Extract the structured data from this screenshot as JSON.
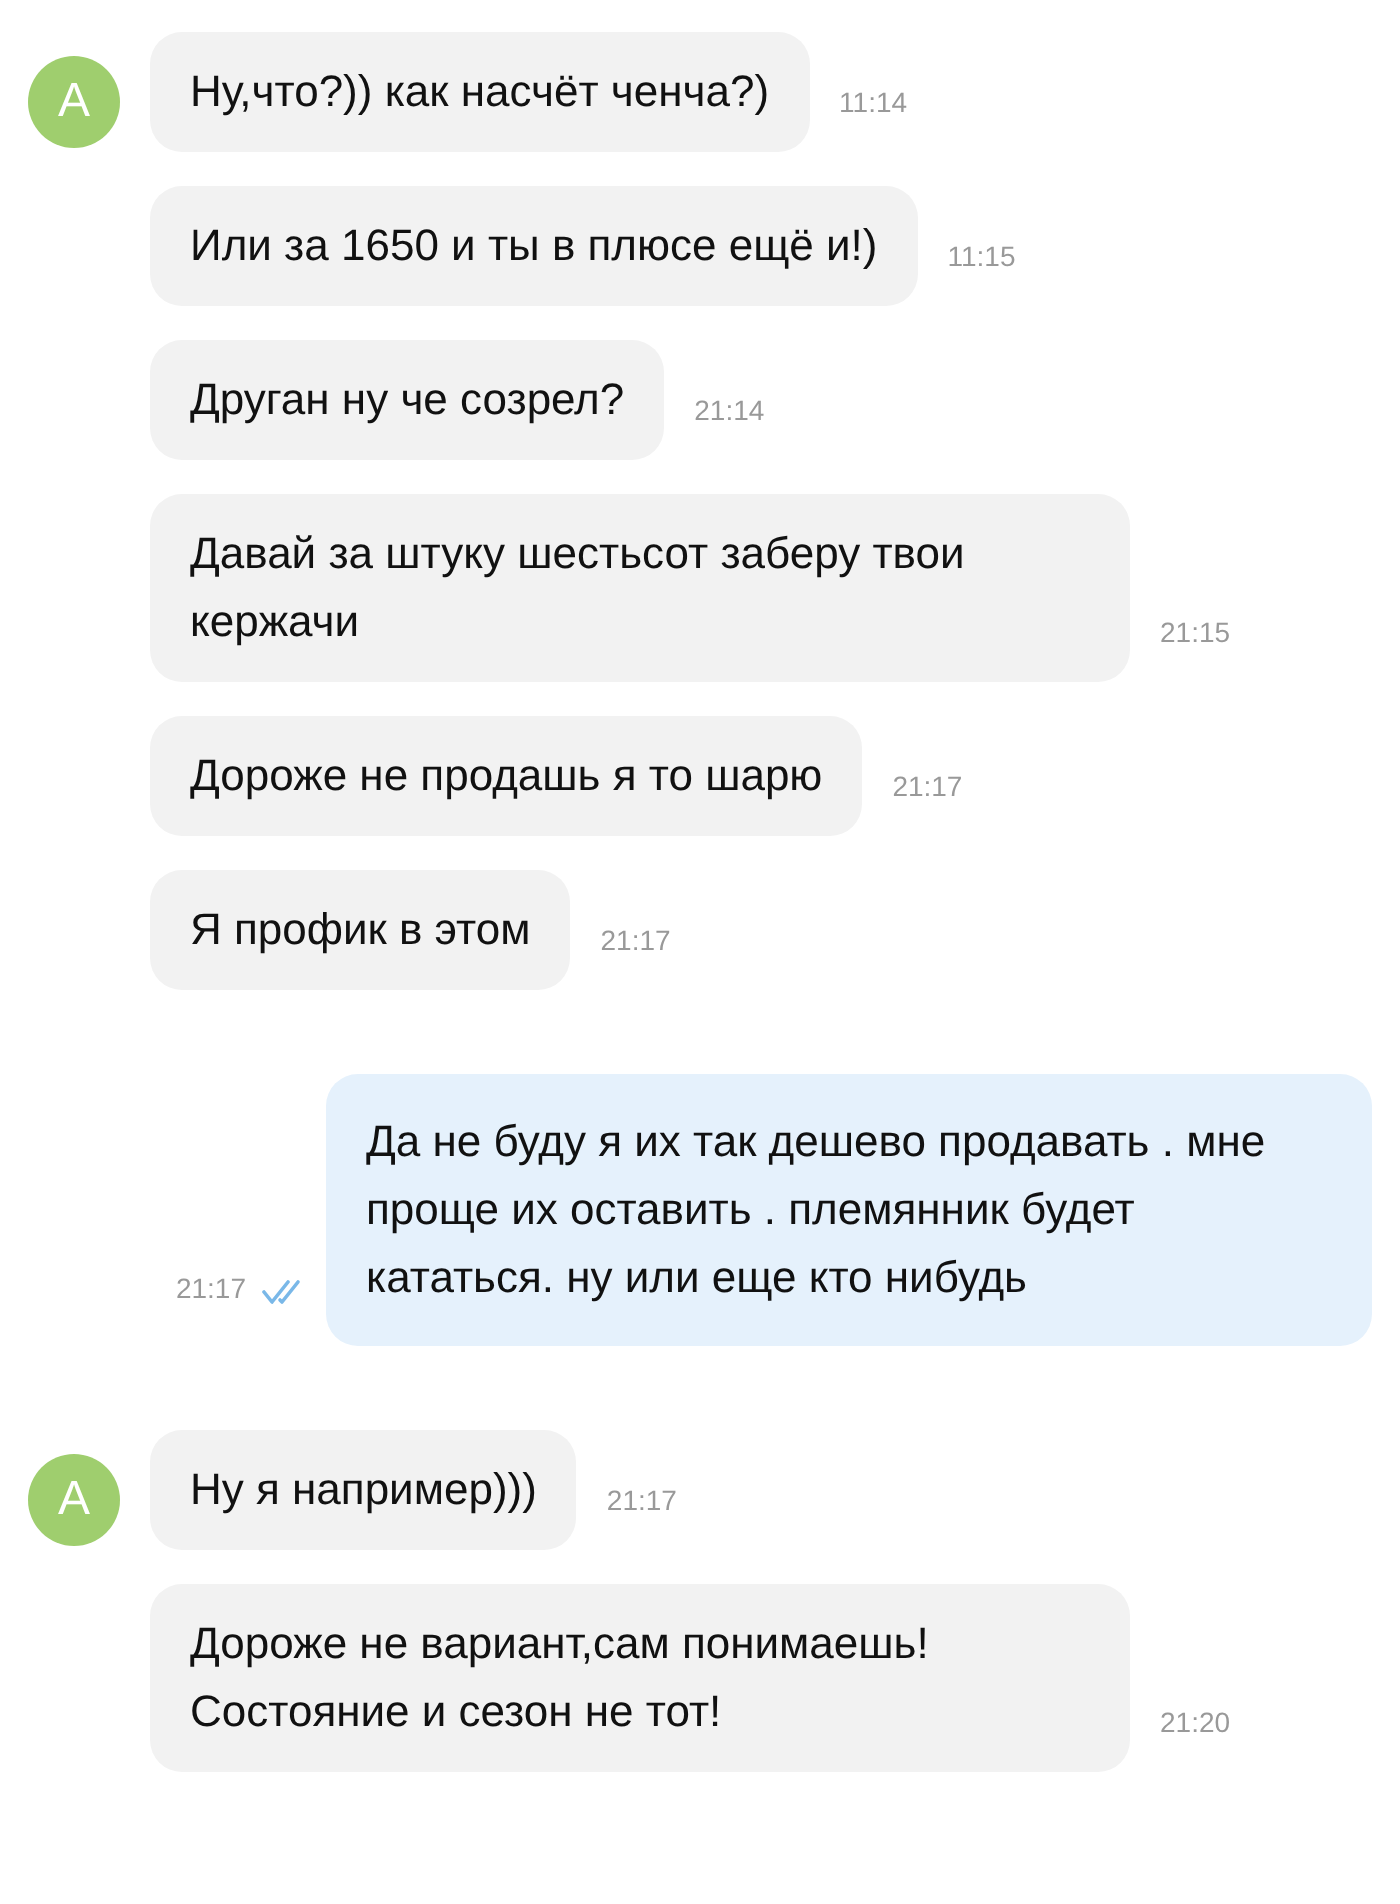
{
  "messages": [
    {
      "kind": "incoming",
      "avatar": "A",
      "text": "Ну,что?)) как насчёт ченча?)",
      "time": "11:14"
    },
    {
      "kind": "incoming",
      "text": "Или за 1650 и ты в плюсе ещё и!)",
      "time": "11:15"
    },
    {
      "kind": "incoming",
      "text": "Друган ну че созрел?",
      "time": "21:14"
    },
    {
      "kind": "incoming",
      "text": "Давай за штуку шестьсот заберу твои кержачи",
      "time": "21:15"
    },
    {
      "kind": "incoming",
      "text": "Дороже не продашь я то шарю",
      "time": "21:17"
    },
    {
      "kind": "incoming",
      "text": "Я профик в этом",
      "time": "21:17"
    },
    {
      "kind": "outgoing",
      "text": "Да не буду я их так дешево продавать . мне проще их оставить . племянник будет кататься. ну или еще кто нибудь",
      "time": "21:17",
      "read": true
    },
    {
      "kind": "incoming",
      "avatar": "A",
      "text": "Ну я например)))",
      "time": "21:17"
    },
    {
      "kind": "incoming",
      "text": "Дороже не вариант,сам понимаешь! Состояние и сезон не тот!",
      "time": "21:20"
    }
  ]
}
